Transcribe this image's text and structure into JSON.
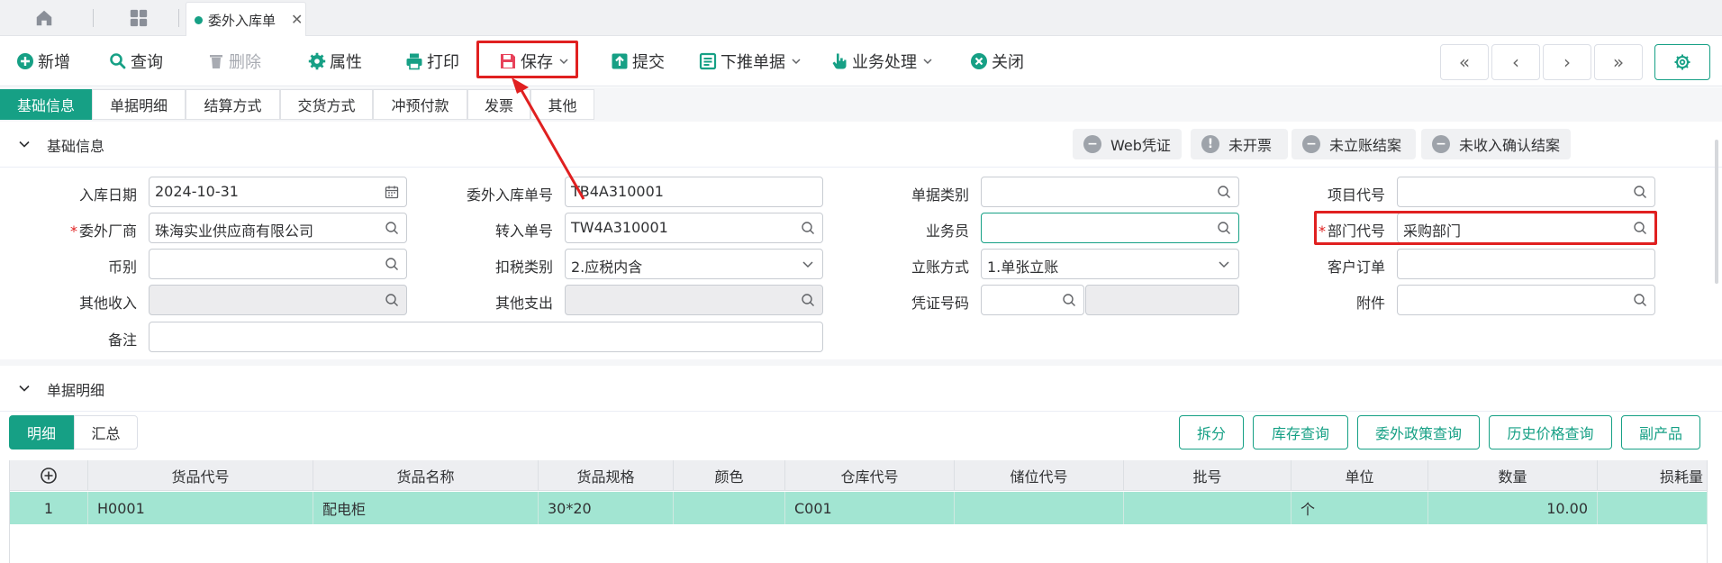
{
  "window_tabs": {
    "doc_tab_title": "委外入库单"
  },
  "toolbar": {
    "add": "新增",
    "query": "查询",
    "delete": "删除",
    "properties": "属性",
    "print": "打印",
    "save": "保存",
    "submit": "提交",
    "push_down": "下推单据",
    "business": "业务处理",
    "close": "关闭"
  },
  "nav": {
    "first": "«",
    "prev": "‹",
    "next": "›",
    "last": "»"
  },
  "section_tabs": [
    "基础信息",
    "单据明细",
    "结算方式",
    "交货方式",
    "冲预付款",
    "发票",
    "其他"
  ],
  "basic_section": {
    "title": "基础信息",
    "status_chips": [
      "Web凭证",
      "未开票",
      "未立账结案",
      "未收入确认结案"
    ]
  },
  "form": {
    "inbound_date": {
      "label": "入库日期",
      "value": "2024-10-31"
    },
    "vendor": {
      "label": "委外厂商",
      "value": "珠海实业供应商有限公司"
    },
    "currency": {
      "label": "币别",
      "value": ""
    },
    "other_income": {
      "label": "其他收入",
      "value": ""
    },
    "remark": {
      "label": "备注",
      "value": ""
    },
    "order_no": {
      "label": "委外入库单号",
      "value": "TB4A310001"
    },
    "transfer_no": {
      "label": "转入单号",
      "value": "TW4A310001"
    },
    "tax_type": {
      "label": "扣税类别",
      "value": "2.应税内含"
    },
    "other_expense": {
      "label": "其他支出",
      "value": ""
    },
    "doc_type": {
      "label": "单据类别",
      "value": ""
    },
    "salesman": {
      "label": "业务员",
      "value": ""
    },
    "account_method": {
      "label": "立账方式",
      "value": "1.单张立账"
    },
    "voucher_no": {
      "label": "凭证号码",
      "value": ""
    },
    "project_code": {
      "label": "项目代号",
      "value": ""
    },
    "dept_code": {
      "label": "部门代号",
      "value": "采购部门"
    },
    "customer_order": {
      "label": "客户订单",
      "value": ""
    },
    "attachment": {
      "label": "附件",
      "value": ""
    }
  },
  "detail_section": {
    "title": "单据明细",
    "seg_detail": "明细",
    "seg_summary": "汇总",
    "buttons": [
      "拆分",
      "库存查询",
      "委外政策查询",
      "历史价格查询",
      "副产品"
    ]
  },
  "grid": {
    "headers": [
      "货品代号",
      "货品名称",
      "货品规格",
      "颜色",
      "仓库代号",
      "储位代号",
      "批号",
      "单位",
      "数量",
      "损耗量"
    ],
    "rows": [
      {
        "index": "1",
        "code": "H0001",
        "name": "配电柜",
        "spec": "30*20",
        "color": "",
        "warehouse": "C001",
        "location": "",
        "batch": "",
        "unit": "个",
        "qty": "10.00",
        "loss": ""
      }
    ]
  },
  "colors": {
    "accent": "#16a085",
    "highlight": "#e02020",
    "row_selected": "#a2e5d2"
  }
}
